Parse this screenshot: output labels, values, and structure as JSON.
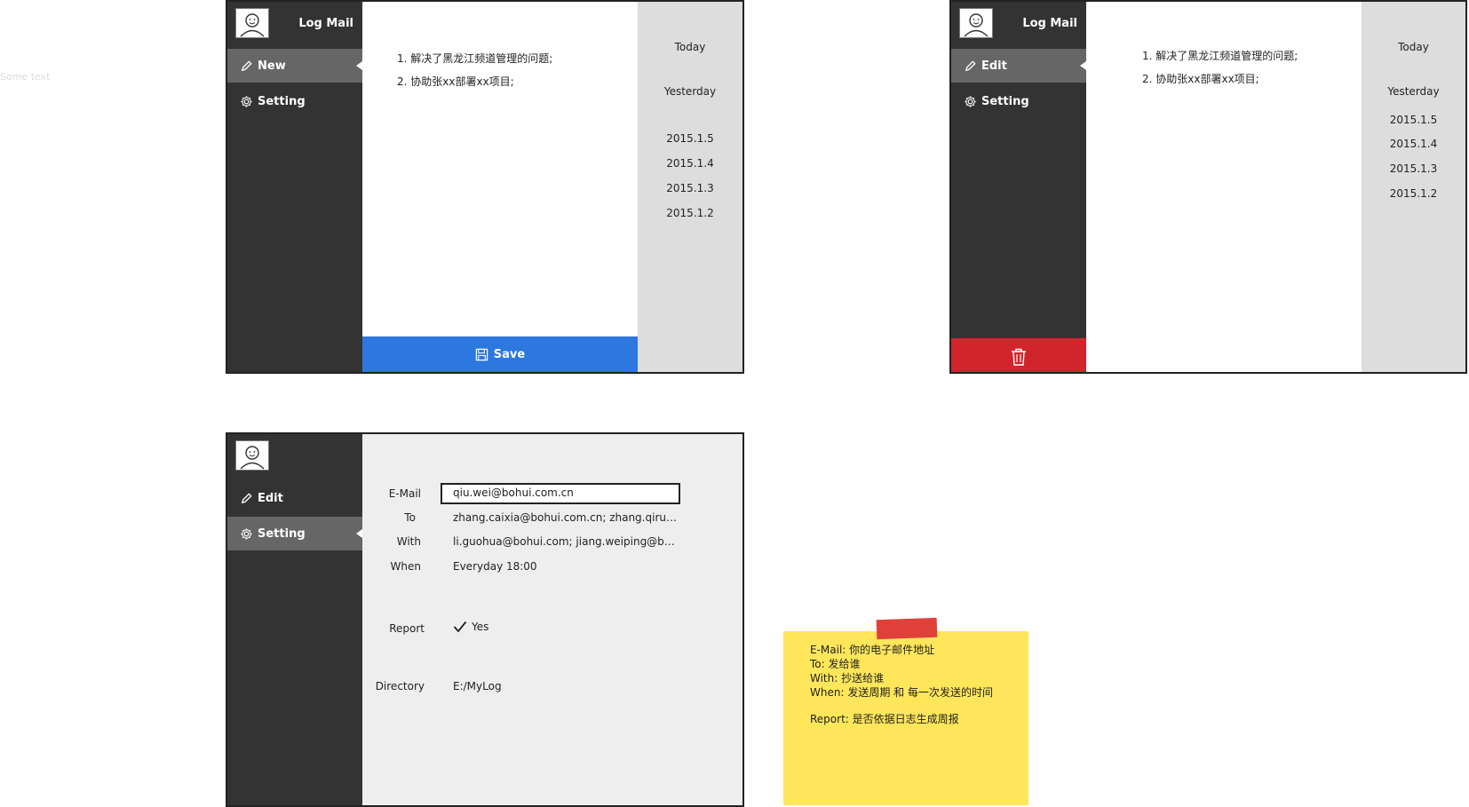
{
  "ghost_text": "Some text",
  "app": {
    "title": "Log Mail"
  },
  "screen1": {
    "nav": {
      "new_label": "New",
      "setting_label": "Setting"
    },
    "note_lines": [
      "1. 解决了黑龙江频道管理的问题;",
      "2. 协助张xx部署xx项目;"
    ],
    "dates": [
      "Today",
      "Yesterday",
      "2015.1.5",
      "2015.1.4",
      "2015.1.3",
      "2015.1.2"
    ],
    "save_label": "Save",
    "save_color": "#2c78de"
  },
  "screen2": {
    "nav": {
      "edit_label": "Edit",
      "setting_label": "Setting"
    },
    "note_lines": [
      "1. 解决了黑龙江频道管理的问题;",
      "2. 协助张xx部署xx项目;"
    ],
    "dates": [
      "Today",
      "Yesterday",
      "2015.1.5",
      "2015.1.4",
      "2015.1.3",
      "2015.1.2"
    ],
    "delete_icon": "trash-icon",
    "delete_color": "#d0262b"
  },
  "screen3": {
    "nav": {
      "edit_label": "Edit",
      "setting_label": "Setting"
    },
    "fields": {
      "email_label": "E-Mail",
      "email_value": "qiu.wei@bohui.com.cn",
      "to_label": "To",
      "to_value": "zhang.caixia@bohui.com.cn; zhang.qirun@bohui.com.cn",
      "with_label": "With",
      "with_value": "li.guohua@bohui.com; jiang.weiping@bohui.com",
      "when_label": "When",
      "when_value": "Everyday 18:00",
      "report_label": "Report",
      "report_value": "Yes",
      "directory_label": "Directory",
      "directory_value": "E:/MyLog"
    }
  },
  "sticky_note": {
    "lines": [
      "E-Mail: 你的电子邮件地址",
      "To: 发给谁",
      "With: 抄送给谁",
      "When: 发送周期 和 每一次发送的时间",
      "Report: 是否依据日志生成周报"
    ]
  }
}
